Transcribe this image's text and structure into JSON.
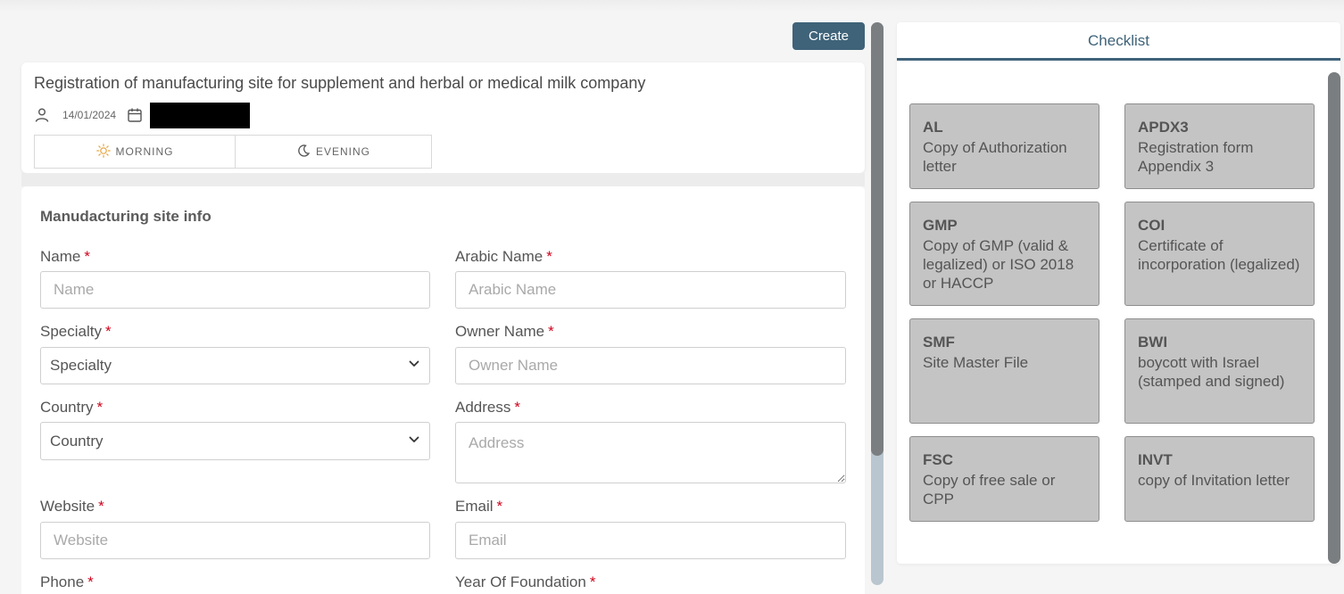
{
  "actions": {
    "create_label": "Create"
  },
  "header": {
    "title": "Registration of manufacturing site for supplement and herbal or medical milk company",
    "date": "14/01/2024",
    "shifts": {
      "morning": "MORNING",
      "evening": "EVENING"
    }
  },
  "form": {
    "section_title": "Manudacturing site info",
    "required_mark": "*",
    "name": {
      "label": "Name",
      "placeholder": "Name"
    },
    "arabic_name": {
      "label": "Arabic Name",
      "placeholder": "Arabic Name"
    },
    "specialty": {
      "label": "Specialty",
      "value": "Specialty"
    },
    "owner_name": {
      "label": "Owner Name",
      "placeholder": "Owner Name"
    },
    "country": {
      "label": "Country",
      "value": "Country"
    },
    "address": {
      "label": "Address",
      "placeholder": "Address"
    },
    "website": {
      "label": "Website",
      "placeholder": "Website"
    },
    "email": {
      "label": "Email",
      "placeholder": "Email"
    },
    "phone": {
      "label": "Phone"
    },
    "year_of_foundation": {
      "label": "Year Of Foundation"
    }
  },
  "checklist": {
    "tab_label": "Checklist",
    "items": [
      {
        "code": "AL",
        "description": "Copy of Authorization letter"
      },
      {
        "code": "APDX3",
        "description": "Registration form Appendix 3"
      },
      {
        "code": "GMP",
        "description": "Copy of GMP (valid & legalized) or ISO 2018 or HACCP"
      },
      {
        "code": "COI",
        "description": "Certificate of incorporation (legalized)"
      },
      {
        "code": "SMF",
        "description": "Site Master File"
      },
      {
        "code": "BWI",
        "description": "boycott with Israel (stamped and signed)"
      },
      {
        "code": "FSC",
        "description": "Copy of free sale or CPP"
      },
      {
        "code": "INVT",
        "description": "copy of Invitation letter"
      }
    ]
  },
  "theme": {
    "accent": "#3f6379",
    "required": "#d0021b",
    "card_bg": "#c4c4c4",
    "sun_icon_color": "#e8a33d"
  },
  "icons": {
    "user": "user-icon",
    "calendar": "calendar-icon",
    "sun": "sun-icon",
    "moon": "moon-icon",
    "chevron": "chevron-down-icon"
  }
}
